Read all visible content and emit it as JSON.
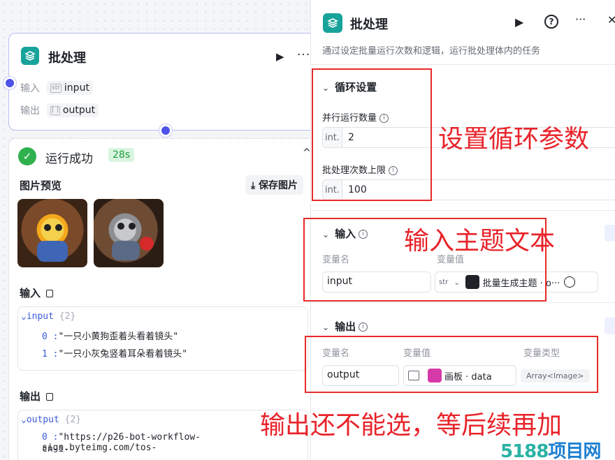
{
  "node": {
    "title": "批处理",
    "inputs_label": "输入",
    "outputs_label": "输出",
    "input_tag": "input",
    "input_tag_type": "str",
    "output_tag": "output"
  },
  "result": {
    "status": "运行成功",
    "duration": "28s",
    "image_preview": "图片预览",
    "save_images": "保存图片",
    "input_label": "输入",
    "output_label": "输出",
    "input_tree": {
      "key": "input",
      "count": "{2}",
      "items": [
        {
          "idx": "0 :",
          "val": "\"一只小黄狗歪着头看着镜头\""
        },
        {
          "idx": "1 :",
          "val": "\"一只小灰兔竖着耳朵看着镜头\""
        }
      ]
    },
    "output_tree": {
      "key": "output",
      "count": "{2}",
      "items": [
        {
          "idx": "0 :",
          "val": "\"https://p26-bot-workflow-sign.byteimg.com/tos-"
        },
        {
          "idx": "",
          "val": "cn-i-"
        }
      ]
    }
  },
  "panel": {
    "title": "批处理",
    "description": "通过设定批量运行次数和逻辑，运行批处理体内的任务",
    "loop": {
      "title": "循环设置",
      "parallel_label": "并行运行数量",
      "parallel_prefix": "int.",
      "parallel_value": "2",
      "max_label": "批处理次数上限",
      "max_prefix": "int.",
      "max_value": "100"
    },
    "input": {
      "title": "输入",
      "col_name": "变量名",
      "col_value": "变量值",
      "var_name": "input",
      "ref_type": "str",
      "ref_value": "批量生成主题 · o···"
    },
    "output": {
      "title": "输出",
      "col_name": "变量名",
      "col_value": "变量值",
      "col_type": "变量类型",
      "var_name": "output",
      "ref_value": "画板 · data",
      "type": "Array<Image>"
    }
  },
  "annotations": {
    "loop": "设置循环参数",
    "input": "输入主题文本",
    "output": "输出还不能选，等后续再加"
  },
  "watermark": {
    "part1": "5188",
    "part2": "项目网"
  },
  "colors": {
    "brand_teal": "#18a39a",
    "port_blue": "#4d53e8",
    "success_green": "#2fb14d",
    "annotation_red": "#e8232a"
  }
}
